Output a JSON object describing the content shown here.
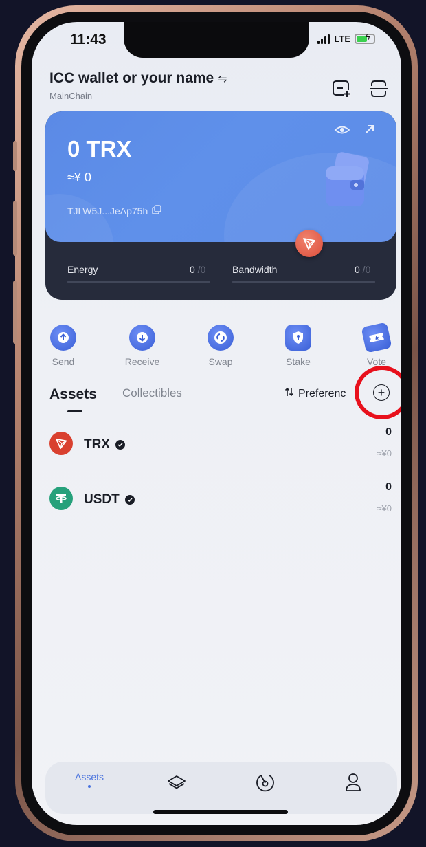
{
  "status": {
    "time": "11:43",
    "network": "LTE"
  },
  "header": {
    "wallet_name": "ICC wallet or your name",
    "switch_glyph": "⇋",
    "chain": "MainChain"
  },
  "card": {
    "balance": "0 TRX",
    "fiat": "≈¥ 0",
    "address": "TJLW5J...JeAp75h",
    "energy_label": "Energy",
    "energy_value": "0",
    "energy_max": " /0",
    "bandwidth_label": "Bandwidth",
    "bandwidth_value": "0",
    "bandwidth_max": " /0"
  },
  "actions": [
    {
      "label": "Send",
      "icon": "arrow-up-icon"
    },
    {
      "label": "Receive",
      "icon": "arrow-down-icon"
    },
    {
      "label": "Swap",
      "icon": "swap-icon"
    },
    {
      "label": "Stake",
      "icon": "shield-icon"
    },
    {
      "label": "Vote",
      "icon": "ticket-icon"
    }
  ],
  "tabs": {
    "assets": "Assets",
    "collectibles": "Collectibles",
    "preferences": "Preferenc",
    "add_glyph": "+"
  },
  "tokens": [
    {
      "symbol": "TRX",
      "amount": "0",
      "fiat": "≈¥0"
    },
    {
      "symbol": "USDT",
      "amount": "0",
      "fiat": "≈¥0"
    }
  ],
  "bottom_nav": {
    "assets": "Assets"
  },
  "colors": {
    "accent": "#4a73de",
    "highlight": "#e8101c",
    "card_blue": "#5b8ae6",
    "trx_red": "#dc4d3b",
    "usdt_green": "#26a17b"
  }
}
